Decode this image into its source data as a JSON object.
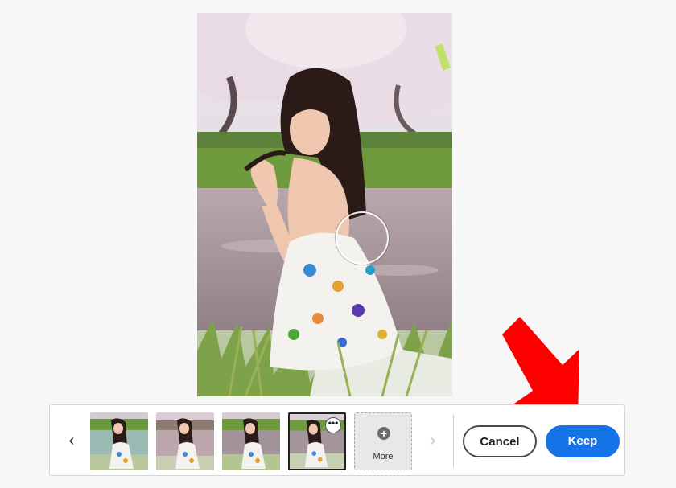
{
  "main_image": {
    "alt": "Woman in floral dress sitting by water under cherry blossoms",
    "icon": "photo"
  },
  "brush_cursor": {
    "icon": "circle-brush-cursor"
  },
  "annotation": {
    "color": "#ff0000",
    "icon": "arrow-pointing-down-left"
  },
  "variations": {
    "prev_icon": "‹",
    "next_icon": "›",
    "thumbnails": [
      {
        "name": "variation-1"
      },
      {
        "name": "variation-2"
      },
      {
        "name": "variation-3"
      },
      {
        "name": "variation-4",
        "selected": true,
        "menu_icon": "•••"
      }
    ],
    "more": {
      "icon": "+",
      "label": "More"
    }
  },
  "actions": {
    "cancel_label": "Cancel",
    "keep_label": "Keep"
  },
  "colors": {
    "accent": "#1473e6",
    "background": "#f7f7f7"
  }
}
